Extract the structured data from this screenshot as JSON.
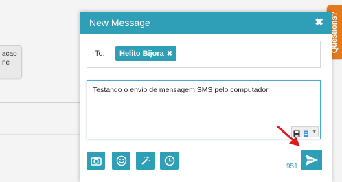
{
  "background": {
    "card_lines": [
      "acao",
      "ne"
    ]
  },
  "questions_tab": {
    "label": "Questions?"
  },
  "modal": {
    "title": "New Message",
    "close_icon": "close-icon",
    "to_label": "To:",
    "recipient": "Helito Bijora",
    "message": "Testando o envio de mensagem SMS pelo computador.",
    "char_count": "951",
    "actions": [
      "camera-icon",
      "smiley-icon",
      "magic-wand-icon",
      "clock-icon"
    ],
    "send_icon": "paper-plane-icon"
  },
  "colors": {
    "accent": "#2e9fb6",
    "questions_tab": "#e07a1c",
    "annotation_arrow": "#e01b1b"
  }
}
